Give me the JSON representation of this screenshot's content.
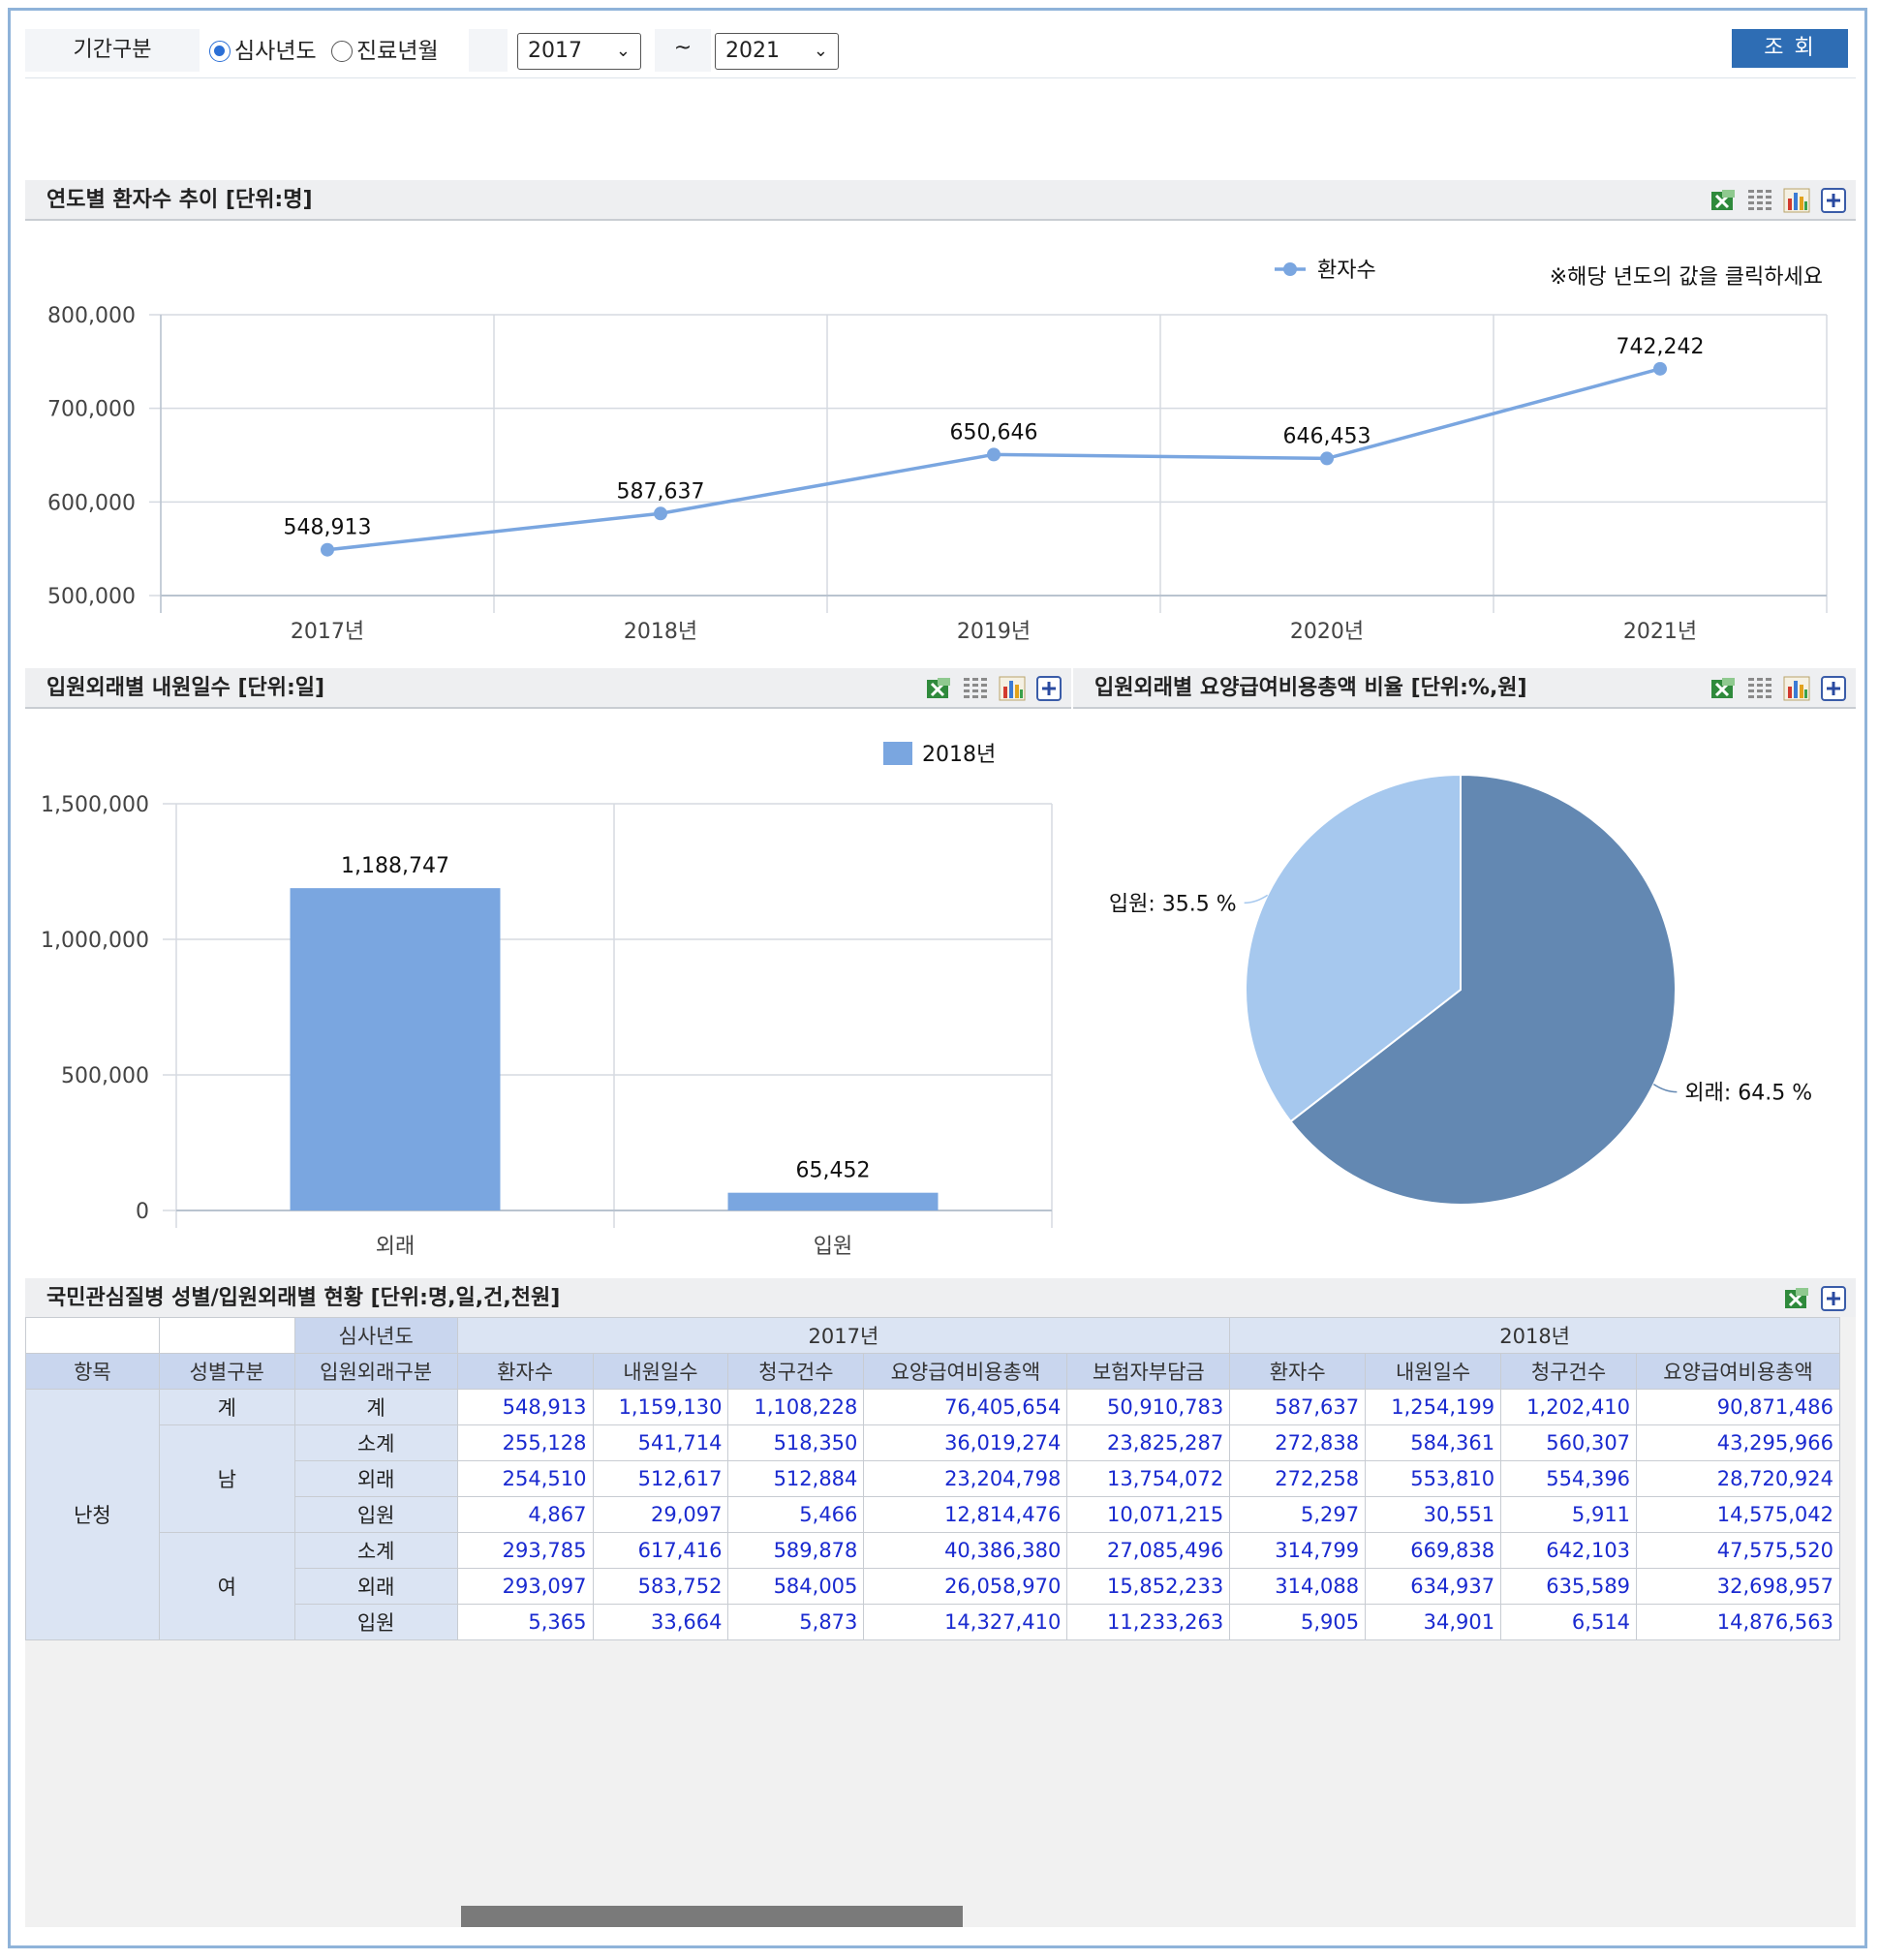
{
  "filter": {
    "label": "기간구분",
    "radio_review_year": "심사년도",
    "radio_treatment_month": "진료년월",
    "from": "2017",
    "tilde": "~",
    "to": "2021",
    "query_button": "조 회"
  },
  "panel_trend": {
    "title": "연도별 환자수 추이 [단위:명]",
    "note": "※해당 년도의 값을 클릭하세요"
  },
  "panel_days": {
    "title": "입원외래별 내원일수 [단위:일]"
  },
  "panel_ratio": {
    "title": "입원외래별 요양급여비용총액 비율 [단위:%,원]"
  },
  "panel_table": {
    "title": "국민관심질병 성별/입원외래별 현황 [단위:명,일,건,천원]"
  },
  "tools": {
    "excel": "excel-icon",
    "grid": "grid-view-icon",
    "chart": "bar-chart-icon",
    "plus": "plus-icon"
  },
  "colors": {
    "line": "#7aa6e0",
    "bar": "#7aa6e0",
    "pie_dark": "#6388b2",
    "pie_light": "#a6c8ee",
    "query_button": "#2e6db4",
    "number_text": "#1a2ad0"
  },
  "chart_data": [
    {
      "type": "line",
      "categories": [
        "2017년",
        "2018년",
        "2019년",
        "2020년",
        "2021년"
      ],
      "series": [
        {
          "name": "환자수",
          "values": [
            548913,
            587637,
            650646,
            646453,
            742242
          ]
        }
      ],
      "data_labels": [
        "548,913",
        "587,637",
        "650,646",
        "646,453",
        "742,242"
      ],
      "ylim": [
        500000,
        800000
      ],
      "yticks": [
        "500,000",
        "600,000",
        "700,000",
        "800,000"
      ],
      "grid": true,
      "legend": "top-right"
    },
    {
      "type": "bar",
      "categories": [
        "외래",
        "입원"
      ],
      "series": [
        {
          "name": "2018년",
          "values": [
            1188747,
            65452
          ]
        }
      ],
      "data_labels": [
        "1,188,747",
        "65,452"
      ],
      "ylim": [
        0,
        1500000
      ],
      "yticks": [
        "0",
        "500,000",
        "1,000,000",
        "1,500,000"
      ],
      "grid": true,
      "legend": "top"
    },
    {
      "type": "pie",
      "slices": [
        {
          "label": "외래: 64.5 %",
          "value": 64.5
        },
        {
          "label": "입원: 35.5 %",
          "value": 35.5
        }
      ]
    }
  ],
  "table": {
    "corner_label": "심사년도",
    "years": [
      "2017년",
      "2018년"
    ],
    "row_headers": [
      "항목",
      "성별구분",
      "입원외래구분"
    ],
    "columns": [
      "환자수",
      "내원일수",
      "청구건수",
      "요양급여비용총액",
      "보험자부담금",
      "환자수",
      "내원일수",
      "청구건수",
      "요양급여비용총액"
    ],
    "item": "난청",
    "rows": [
      {
        "sex": "계",
        "type": "계",
        "values": [
          "548,913",
          "1,159,130",
          "1,108,228",
          "76,405,654",
          "50,910,783",
          "587,637",
          "1,254,199",
          "1,202,410",
          "90,871,486"
        ]
      },
      {
        "sex": "남",
        "type": "소계",
        "values": [
          "255,128",
          "541,714",
          "518,350",
          "36,019,274",
          "23,825,287",
          "272,838",
          "584,361",
          "560,307",
          "43,295,966"
        ]
      },
      {
        "sex": "",
        "type": "외래",
        "values": [
          "254,510",
          "512,617",
          "512,884",
          "23,204,798",
          "13,754,072",
          "272,258",
          "553,810",
          "554,396",
          "28,720,924"
        ]
      },
      {
        "sex": "",
        "type": "입원",
        "values": [
          "4,867",
          "29,097",
          "5,466",
          "12,814,476",
          "10,071,215",
          "5,297",
          "30,551",
          "5,911",
          "14,575,042"
        ]
      },
      {
        "sex": "여",
        "type": "소계",
        "values": [
          "293,785",
          "617,416",
          "589,878",
          "40,386,380",
          "27,085,496",
          "314,799",
          "669,838",
          "642,103",
          "47,575,520"
        ]
      },
      {
        "sex": "",
        "type": "외래",
        "values": [
          "293,097",
          "583,752",
          "584,005",
          "26,058,970",
          "15,852,233",
          "314,088",
          "634,937",
          "635,589",
          "32,698,957"
        ]
      },
      {
        "sex": "",
        "type": "입원",
        "values": [
          "5,365",
          "33,664",
          "5,873",
          "14,327,410",
          "11,233,263",
          "5,905",
          "34,901",
          "6,514",
          "14,876,563"
        ]
      }
    ]
  }
}
